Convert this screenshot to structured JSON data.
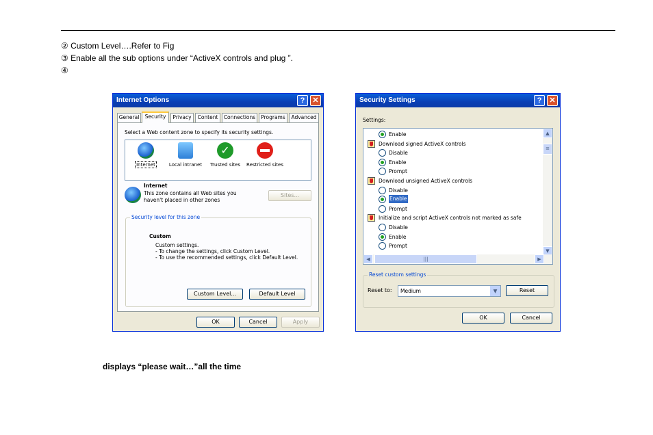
{
  "document": {
    "step2": "② Custom Level….Refer to Fig",
    "step3": "③ Enable all the sub options under “ActiveX controls and plug ”.",
    "step4": "④",
    "note": "displays “please wait…”all the time"
  },
  "internet_options": {
    "title": "Internet Options",
    "help_btn": "?",
    "close_btn": "✕",
    "tabs": [
      "General",
      "Security",
      "Privacy",
      "Content",
      "Connections",
      "Programs",
      "Advanced"
    ],
    "instruction": "Select a Web content zone to specify its security settings.",
    "zones": [
      "Internet",
      "Local intranet",
      "Trusted sites",
      "Restricted sites"
    ],
    "zone_title": "Internet",
    "zone_desc_1": "This zone contains all Web sites you",
    "zone_desc_2": "haven't placed in other zones",
    "sites_btn": "Sites...",
    "security_level_legend": "Security level for this zone",
    "custom_title": "Custom",
    "custom_line1": "Custom settings.",
    "custom_line2": "- To change the settings, click Custom Level.",
    "custom_line3": "- To use the recommended settings, click Default Level.",
    "custom_level_btn": "Custom Level...",
    "default_level_btn": "Default Level",
    "ok_btn": "OK",
    "cancel_btn": "Cancel",
    "apply_btn": "Apply"
  },
  "security_settings": {
    "title": "Security Settings",
    "help_btn": "?",
    "close_btn": "✕",
    "settings_label": "Settings:",
    "items": [
      {
        "kind": "radio",
        "label": "Enable",
        "on": true
      },
      {
        "kind": "header",
        "label": "Download signed ActiveX controls"
      },
      {
        "kind": "radio",
        "label": "Disable",
        "on": false
      },
      {
        "kind": "radio",
        "label": "Enable",
        "on": true
      },
      {
        "kind": "radio",
        "label": "Prompt",
        "on": false
      },
      {
        "kind": "header",
        "label": "Download unsigned ActiveX controls"
      },
      {
        "kind": "radio",
        "label": "Disable",
        "on": false
      },
      {
        "kind": "radio",
        "label": "Enable",
        "on": true,
        "selected": true
      },
      {
        "kind": "radio",
        "label": "Prompt",
        "on": false
      },
      {
        "kind": "header",
        "label": "Initialize and script ActiveX controls not marked as safe"
      },
      {
        "kind": "radio",
        "label": "Disable",
        "on": false
      },
      {
        "kind": "radio",
        "label": "Enable",
        "on": true
      },
      {
        "kind": "radio",
        "label": "Prompt",
        "on": false
      }
    ],
    "reset_legend": "Reset custom settings",
    "reset_to_label": "Reset to:",
    "reset_value": "Medium",
    "reset_btn": "Reset",
    "ok_btn": "OK",
    "cancel_btn": "Cancel"
  }
}
